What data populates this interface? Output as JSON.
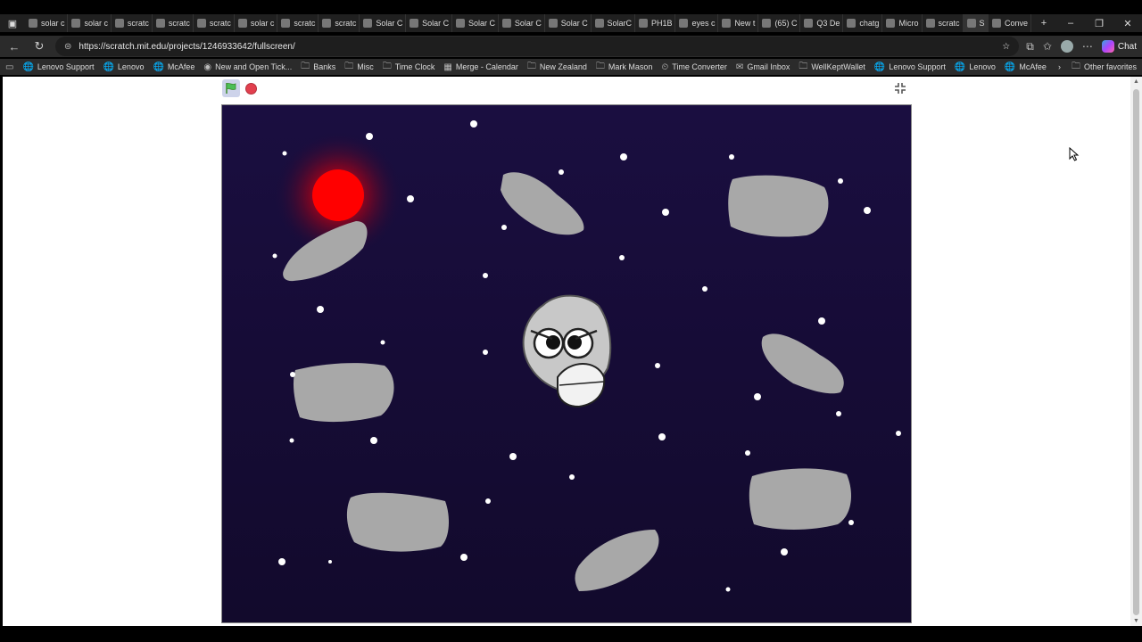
{
  "browser": {
    "tabs": [
      {
        "label": "solar c"
      },
      {
        "label": "solar c"
      },
      {
        "label": "scratc"
      },
      {
        "label": "scratc"
      },
      {
        "label": "scratc"
      },
      {
        "label": "solar c"
      },
      {
        "label": "scratc"
      },
      {
        "label": "scratc"
      },
      {
        "label": "Solar C"
      },
      {
        "label": "Solar C"
      },
      {
        "label": "Solar C"
      },
      {
        "label": "Solar C"
      },
      {
        "label": "Solar C"
      },
      {
        "label": "SolarC"
      },
      {
        "label": "PH1B"
      },
      {
        "label": "eyes c"
      },
      {
        "label": "New t"
      },
      {
        "label": "(65) C"
      },
      {
        "label": "Q3 De"
      },
      {
        "label": "chatg"
      },
      {
        "label": "Micro"
      },
      {
        "label": "scratc"
      },
      {
        "label": "S"
      },
      {
        "label": "Conve"
      }
    ],
    "url": "https://scratch.mit.edu/projects/1246933642/fullscreen/",
    "chat_label": "Chat",
    "bookmarks": [
      {
        "label": "Lenovo Support",
        "icon": "globe-icon"
      },
      {
        "label": "Lenovo",
        "icon": "globe-icon"
      },
      {
        "label": "McAfee",
        "icon": "globe-icon"
      },
      {
        "label": "New and Open Tick...",
        "icon": "ticket-icon"
      },
      {
        "label": "Banks",
        "icon": "folder-icon"
      },
      {
        "label": "Misc",
        "icon": "folder-icon"
      },
      {
        "label": "Time Clock",
        "icon": "folder-icon"
      },
      {
        "label": "Merge - Calendar",
        "icon": "calendar-icon"
      },
      {
        "label": "New Zealand",
        "icon": "folder-icon"
      },
      {
        "label": "Mark Mason",
        "icon": "folder-icon"
      },
      {
        "label": "Time Converter",
        "icon": "clock-icon"
      },
      {
        "label": "Gmail Inbox",
        "icon": "mail-icon"
      },
      {
        "label": "WellKeptWallet",
        "icon": "folder-icon"
      },
      {
        "label": "Lenovo Support",
        "icon": "globe-icon"
      },
      {
        "label": "Lenovo",
        "icon": "globe-icon"
      },
      {
        "label": "McAfee",
        "icon": "globe-icon"
      }
    ],
    "other_favorites": "Other favorites"
  },
  "colors": {
    "stage_bg": "#170c38",
    "asteroid": "#a8a8a8",
    "sun": "#ff0000",
    "star": "#ffffff"
  }
}
